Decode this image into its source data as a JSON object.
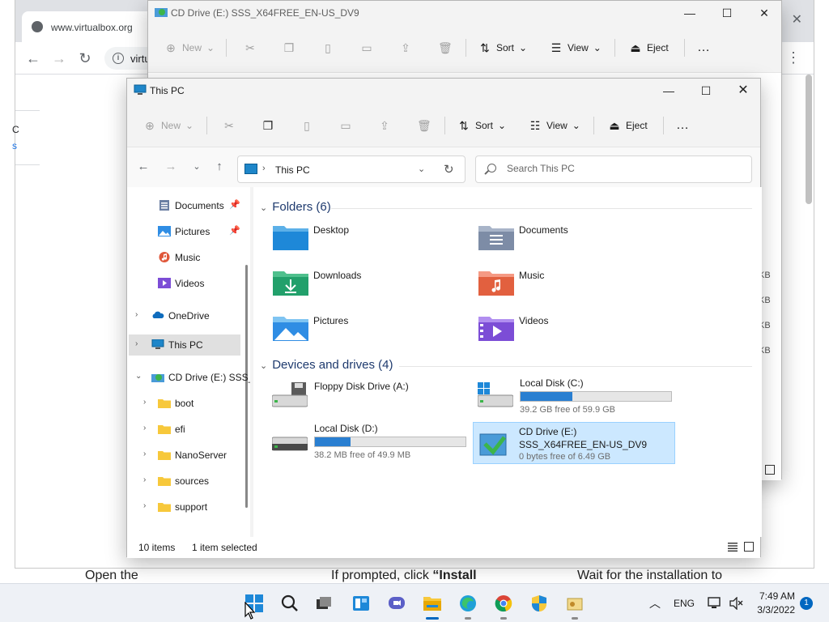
{
  "browser": {
    "tab_url": "www.virtualbox.org",
    "omnibox_text": "virtu",
    "close_glyph": "✕",
    "left_text_1": "C",
    "left_text_2": "s",
    "bottom_text_1": "Open the",
    "bottom_text_2_prefix": "If prompted, click ",
    "bottom_text_2_bold": "“Install",
    "bottom_text_3": "Wait for the installation to"
  },
  "back_window": {
    "title": "CD Drive (E:) SSS_X64FREE_EN-US_DV9",
    "cmd": {
      "new": "New",
      "sort": "Sort",
      "view": "View",
      "eject": "Eject",
      "more": "…"
    },
    "size_suffixes": [
      "KB",
      "KB",
      "KB",
      "KB"
    ]
  },
  "front_window": {
    "title": "This PC",
    "cmd": {
      "new": "New",
      "sort": "Sort",
      "view": "View",
      "eject": "Eject",
      "more": "…"
    },
    "address": {
      "text": "This PC"
    },
    "search": {
      "placeholder": "Search This PC"
    },
    "nav": [
      {
        "label": "Documents",
        "icon": "documents-icon",
        "pinned": true
      },
      {
        "label": "Pictures",
        "icon": "pictures-icon",
        "pinned": true
      },
      {
        "label": "Music",
        "icon": "music-icon",
        "pinned": false
      },
      {
        "label": "Videos",
        "icon": "videos-icon",
        "pinned": false
      },
      {
        "label": "OneDrive",
        "icon": "onedrive-icon"
      },
      {
        "label": "This PC",
        "icon": "this-pc-icon",
        "selected": true
      },
      {
        "label": "CD Drive (E:) SSS_",
        "icon": "cd-drive-icon",
        "expanded": true
      },
      {
        "label": "boot",
        "icon": "folder-icon"
      },
      {
        "label": "efi",
        "icon": "folder-icon"
      },
      {
        "label": "NanoServer",
        "icon": "folder-icon"
      },
      {
        "label": "sources",
        "icon": "folder-icon"
      },
      {
        "label": "support",
        "icon": "folder-icon"
      }
    ],
    "folders_header": "Folders (6)",
    "folders": [
      {
        "label": "Desktop",
        "icon": "desktop-folder-icon"
      },
      {
        "label": "Documents",
        "icon": "documents-folder-icon"
      },
      {
        "label": "Downloads",
        "icon": "downloads-folder-icon"
      },
      {
        "label": "Music",
        "icon": "music-folder-icon"
      },
      {
        "label": "Pictures",
        "icon": "pictures-folder-icon"
      },
      {
        "label": "Videos",
        "icon": "videos-folder-icon"
      }
    ],
    "drives_header": "Devices and drives (4)",
    "drives": [
      {
        "name": "Floppy Disk Drive (A:)",
        "icon": "floppy-drive-icon"
      },
      {
        "name": "Local Disk (C:)",
        "icon": "windows-drive-icon",
        "used_fraction": 0.346,
        "free": "39.2 GB free of 59.9 GB"
      },
      {
        "name": "Local Disk (D:)",
        "icon": "hard-drive-icon",
        "used_fraction": 0.234,
        "free": "38.2 MB free of 49.9 MB"
      },
      {
        "name": "CD Drive (E:)",
        "name2": "SSS_X64FREE_EN-US_DV9",
        "icon": "cd-drive-icon",
        "free": "0 bytes free of 6.49 GB",
        "selected": true
      }
    ],
    "status": {
      "items": "10 items",
      "selected": "1 item selected"
    }
  },
  "taskbar": {
    "lang": "ENG",
    "time": "7:49 AM",
    "date": "3/3/2022",
    "notification_count": "1",
    "apps": [
      "start-icon",
      "search-icon",
      "task-view-icon",
      "widgets-icon",
      "teams-chat-icon",
      "file-explorer-icon",
      "edge-icon",
      "chrome-icon",
      "security-icon",
      "app-icon"
    ]
  },
  "colors": {
    "accent": "#0067c0",
    "drive_bar": "#2a7fd1",
    "selection": "#cce8ff"
  }
}
